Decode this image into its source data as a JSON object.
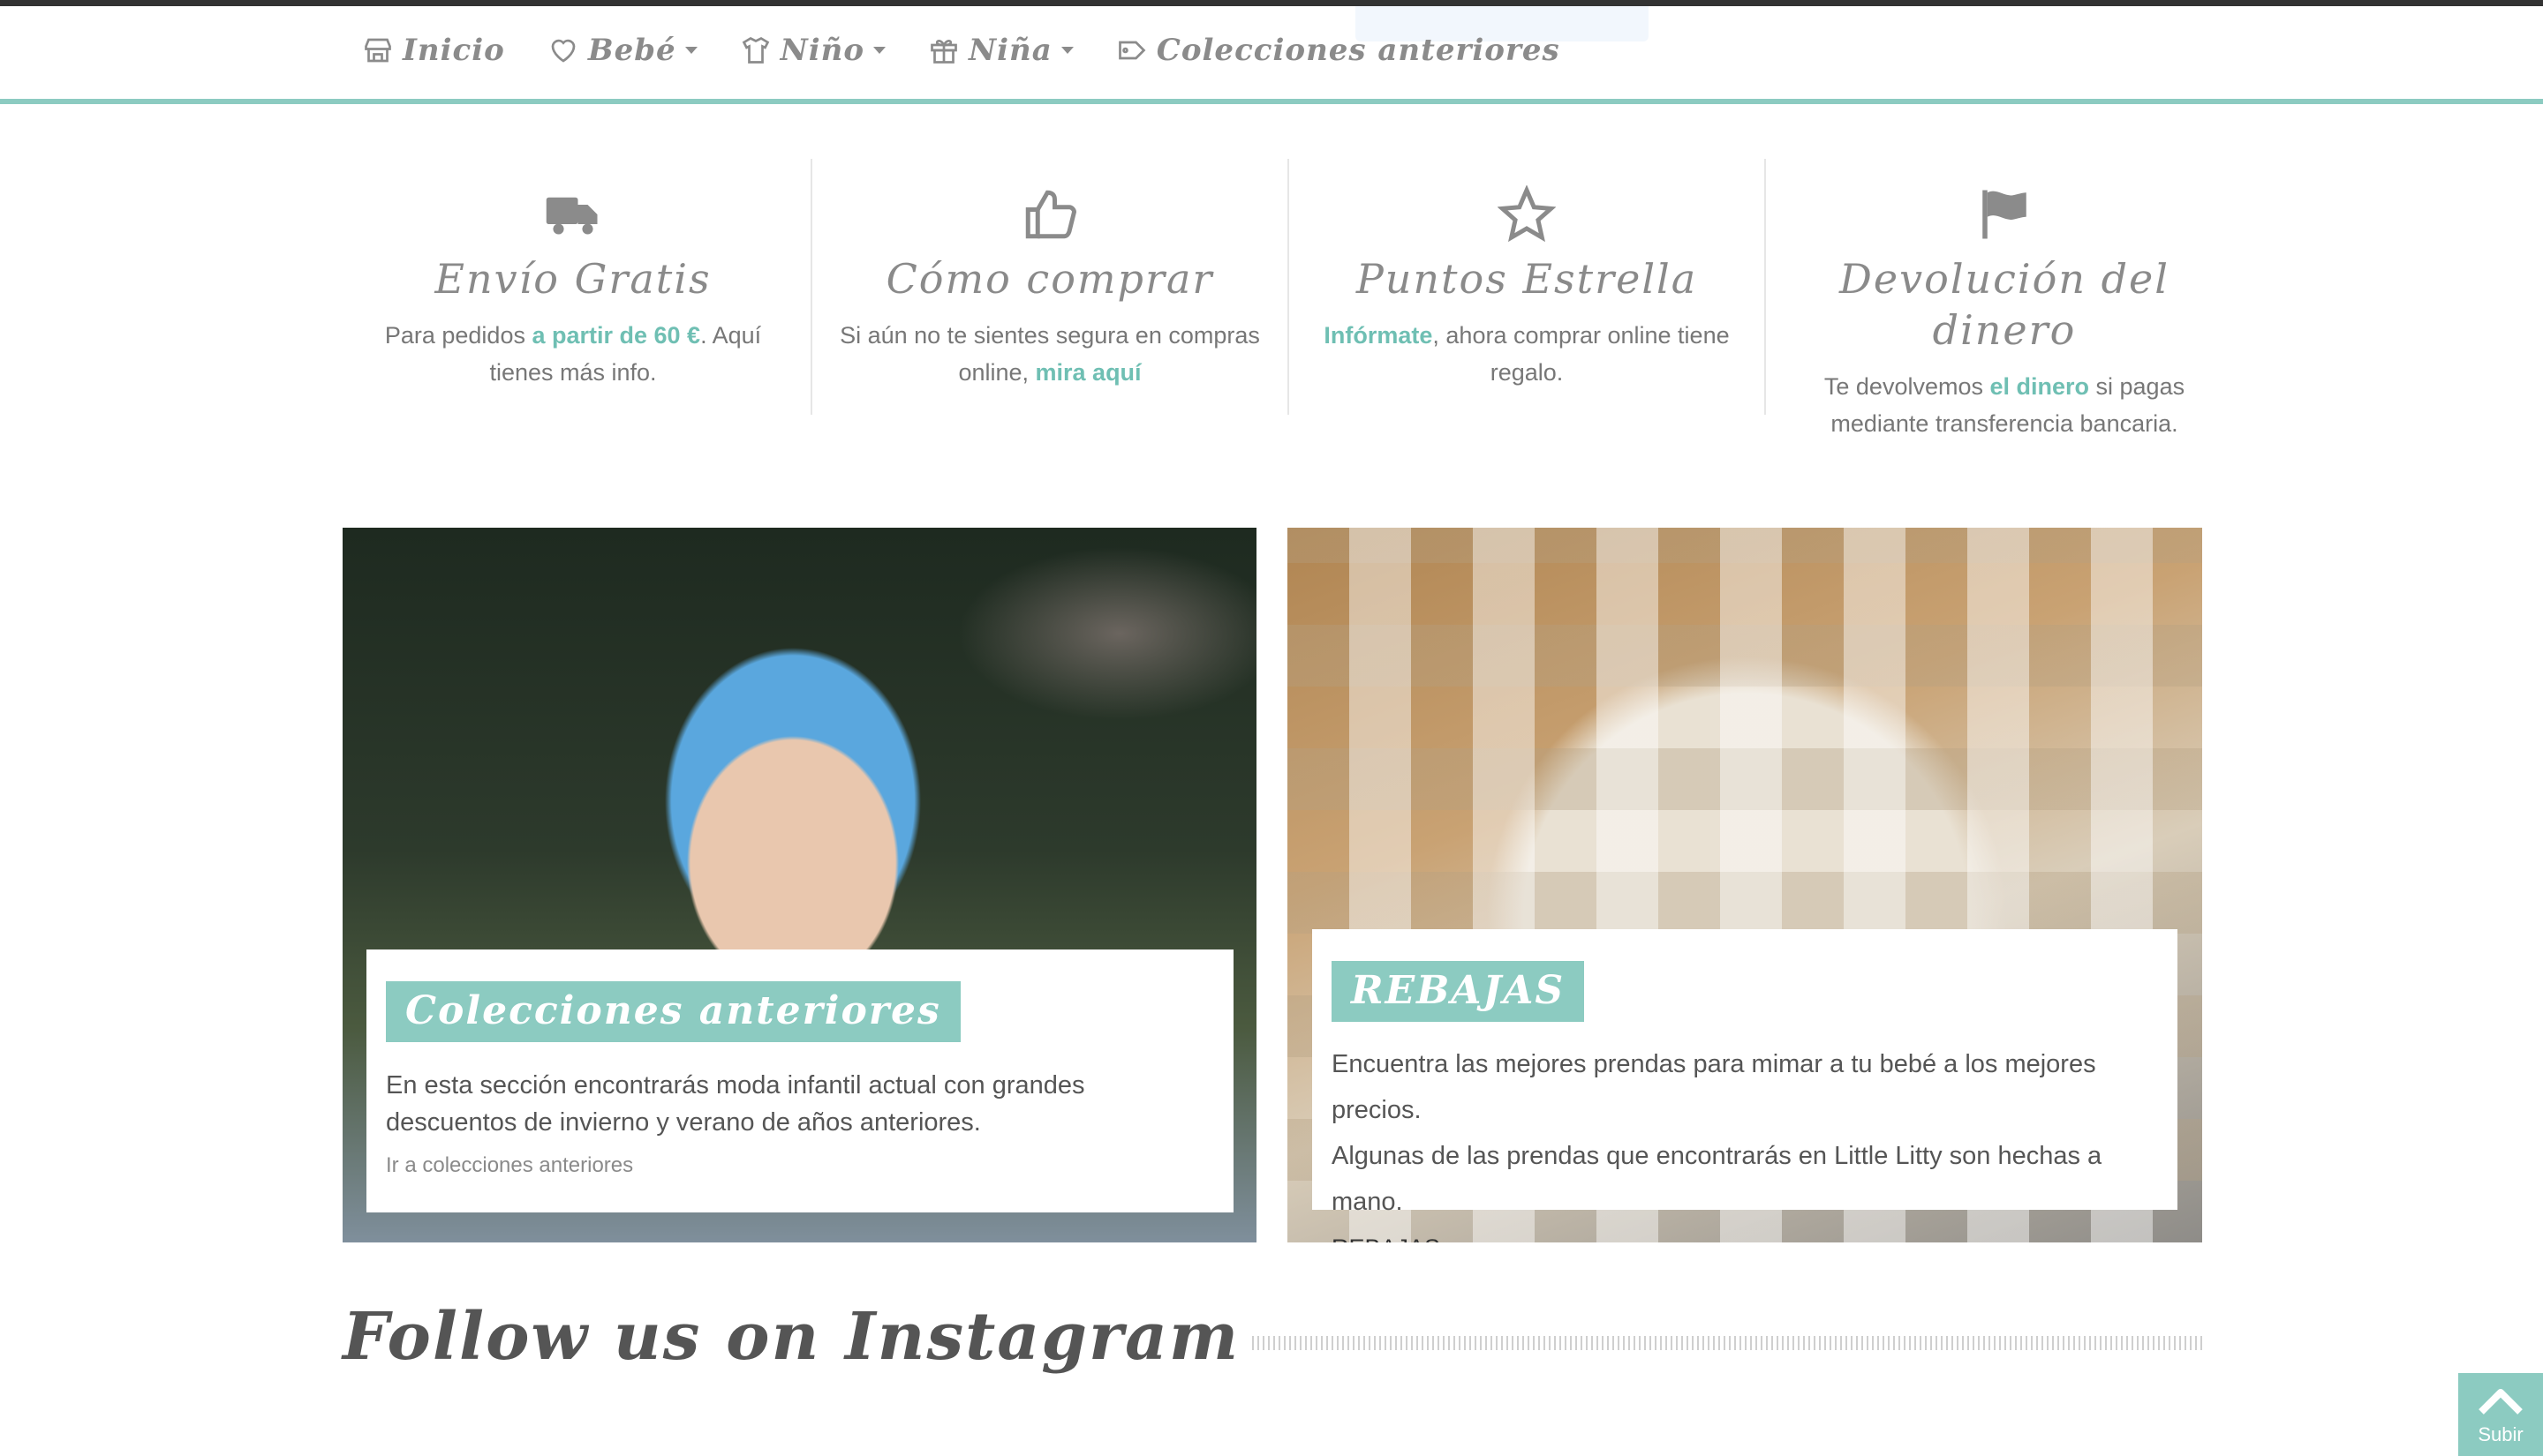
{
  "nav": {
    "items": [
      {
        "label": "Inicio",
        "icon": "store-icon",
        "dropdown": false
      },
      {
        "label": "Bebé",
        "icon": "heart-icon",
        "dropdown": true
      },
      {
        "label": "Niño",
        "icon": "shirt-icon",
        "dropdown": true
      },
      {
        "label": "Niña",
        "icon": "gift-icon",
        "dropdown": true
      },
      {
        "label": "Colecciones anteriores",
        "icon": "tag-icon",
        "dropdown": false
      }
    ]
  },
  "features": [
    {
      "icon": "truck-icon",
      "title": "Envío Gratis",
      "text_before": "Para pedidos ",
      "link": "a partir de 60 €",
      "text_after": ". Aquí tienes más info."
    },
    {
      "icon": "thumbs-up-icon",
      "title": "Cómo comprar",
      "text_before": "Si aún no te sientes segura en compras online, ",
      "link": "mira aquí",
      "text_after": ""
    },
    {
      "icon": "star-icon",
      "title": "Puntos Estrella",
      "text_before": "",
      "link": "Infórmate",
      "text_after": ", ahora comprar online tiene regalo."
    },
    {
      "icon": "flag-icon",
      "title": "Devolución del dinero",
      "text_before": "Te devolvemos ",
      "link": "el dinero",
      "text_after": " si pagas mediante transferencia bancaria."
    }
  ],
  "banners": {
    "left": {
      "tag": "Colecciones anteriores",
      "text": "En esta sección encontrarás moda infantil actual con grandes descuentos de invierno y verano de años anteriores.",
      "link": "Ir a colecciones anteriores"
    },
    "right": {
      "tag": "REBAJAS",
      "text_line1": "Encuentra las mejores prendas para mimar a tu bebé a los mejores precios.",
      "text_line2": "Algunas de las prendas que encontrarás en Little Litty son hechas a mano.",
      "link": "REBAJAS"
    }
  },
  "instagram": {
    "title": "Follow us on Instagram"
  },
  "scroll_top": {
    "label": "Subir",
    "icon": "chevron-up-icon"
  },
  "colors": {
    "accent": "#8ccbc1",
    "link": "#6fbfb3",
    "icon_gray": "#8b8b8b"
  }
}
